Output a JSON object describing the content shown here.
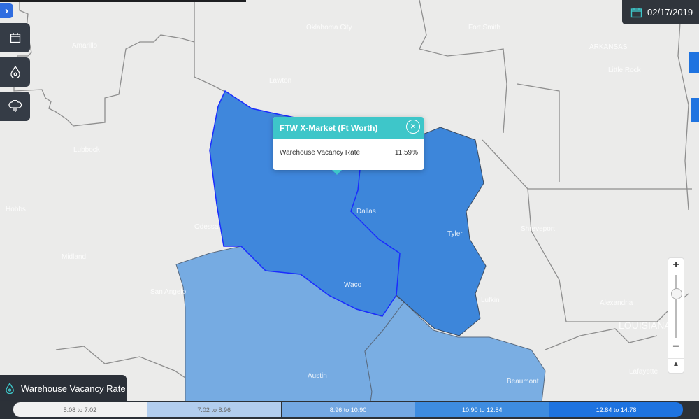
{
  "header": {
    "date": "02/17/2019",
    "icon": "calendar-icon"
  },
  "sidebar": {
    "expand_icon": "chevron-right-icon",
    "buttons": [
      {
        "name": "date-button",
        "icon": "calendar-icon"
      },
      {
        "name": "metric-button",
        "icon": "droplet-icon"
      },
      {
        "name": "weather-button",
        "icon": "cloud-rain-icon"
      }
    ]
  },
  "map": {
    "cities": [
      "Oklahoma City",
      "Fort Smith",
      "Amarillo",
      "ARKANSAS",
      "Little Rock",
      "Lawton",
      "Lubbock",
      "Hobbs",
      "Odessa",
      "Midland",
      "Dallas",
      "Tyler",
      "Shreveport",
      "Waco",
      "San Angelo",
      "Lufkin",
      "Alexandria",
      "Austin",
      "Beaumont",
      "Lafayette",
      "LOUISIANA"
    ],
    "region_colors": {
      "selected": "#3f87dc",
      "east": "#3d86da",
      "southwest": "#76abe2",
      "southeast": "#7aaee3",
      "border": "#1a2cff"
    }
  },
  "popup": {
    "title": "FTW X-Market (Ft Worth)",
    "metric_label": "Warehouse Vacancy Rate",
    "metric_value": "11.59%",
    "accent": "#3ec6c9"
  },
  "zoom_control": {
    "zoom_in": "+",
    "zoom_out": "−",
    "compass": "▲"
  },
  "layer": {
    "label": "Warehouse Vacancy Rate",
    "icon": "droplet-icon"
  },
  "legend": [
    {
      "label": "5.08 to 7.02",
      "color": "#f1f1f1"
    },
    {
      "label": "7.02 to 8.96",
      "color": "#b2cdee"
    },
    {
      "label": "8.96 to 10.90",
      "color": "#74a8e3"
    },
    {
      "label": "10.90 to 12.84",
      "color": "#3e8ce0"
    },
    {
      "label": "12.84 to 14.78",
      "color": "#1e73e0"
    }
  ]
}
